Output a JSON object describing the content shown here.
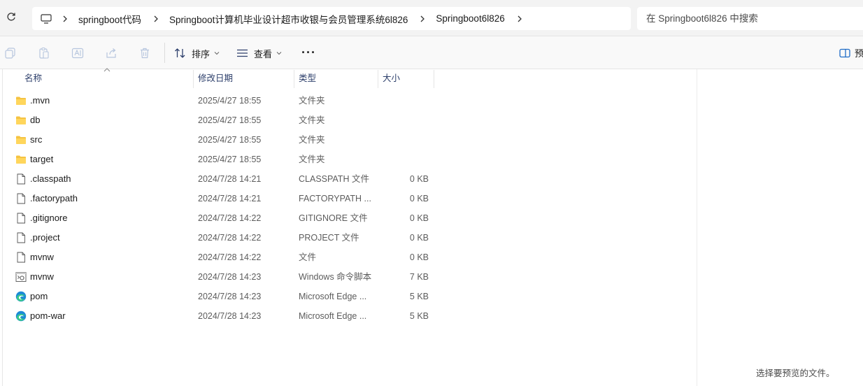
{
  "address_bar": {
    "breadcrumbs": [
      "springboot代码",
      "Springboot计算机毕业设计超市收银与会员管理系统6l826",
      "Springboot6l826"
    ],
    "search_placeholder": "在 Springboot6l826 中搜索"
  },
  "command_bar": {
    "sort_label": "排序",
    "view_label": "查看",
    "more_label": "···",
    "preview_label": "预"
  },
  "columns": {
    "name": "名称",
    "modified": "修改日期",
    "type": "类型",
    "size": "大小"
  },
  "files": [
    {
      "icon": "folder-icon",
      "name": ".mvn",
      "modified": "2025/4/27 18:55",
      "type": "文件夹",
      "size": ""
    },
    {
      "icon": "folder-icon",
      "name": "db",
      "modified": "2025/4/27 18:55",
      "type": "文件夹",
      "size": ""
    },
    {
      "icon": "folder-icon",
      "name": "src",
      "modified": "2025/4/27 18:55",
      "type": "文件夹",
      "size": ""
    },
    {
      "icon": "folder-icon",
      "name": "target",
      "modified": "2025/4/27 18:55",
      "type": "文件夹",
      "size": ""
    },
    {
      "icon": "file-icon",
      "name": ".classpath",
      "modified": "2024/7/28 14:21",
      "type": "CLASSPATH 文件",
      "size": "0 KB"
    },
    {
      "icon": "file-icon",
      "name": ".factorypath",
      "modified": "2024/7/28 14:21",
      "type": "FACTORYPATH ...",
      "size": "0 KB"
    },
    {
      "icon": "file-icon",
      "name": ".gitignore",
      "modified": "2024/7/28 14:22",
      "type": "GITIGNORE 文件",
      "size": "0 KB"
    },
    {
      "icon": "file-icon",
      "name": ".project",
      "modified": "2024/7/28 14:22",
      "type": "PROJECT 文件",
      "size": "0 KB"
    },
    {
      "icon": "file-icon",
      "name": "mvnw",
      "modified": "2024/7/28 14:22",
      "type": "文件",
      "size": "0 KB"
    },
    {
      "icon": "cmd-script-icon",
      "name": "mvnw",
      "modified": "2024/7/28 14:23",
      "type": "Windows 命令脚本",
      "size": "7 KB"
    },
    {
      "icon": "edge-icon",
      "name": "pom",
      "modified": "2024/7/28 14:23",
      "type": "Microsoft Edge ...",
      "size": "5 KB"
    },
    {
      "icon": "edge-icon",
      "name": "pom-war",
      "modified": "2024/7/28 14:23",
      "type": "Microsoft Edge ...",
      "size": "5 KB"
    }
  ],
  "preview_pane": {
    "message": "选择要预览的文件。"
  }
}
